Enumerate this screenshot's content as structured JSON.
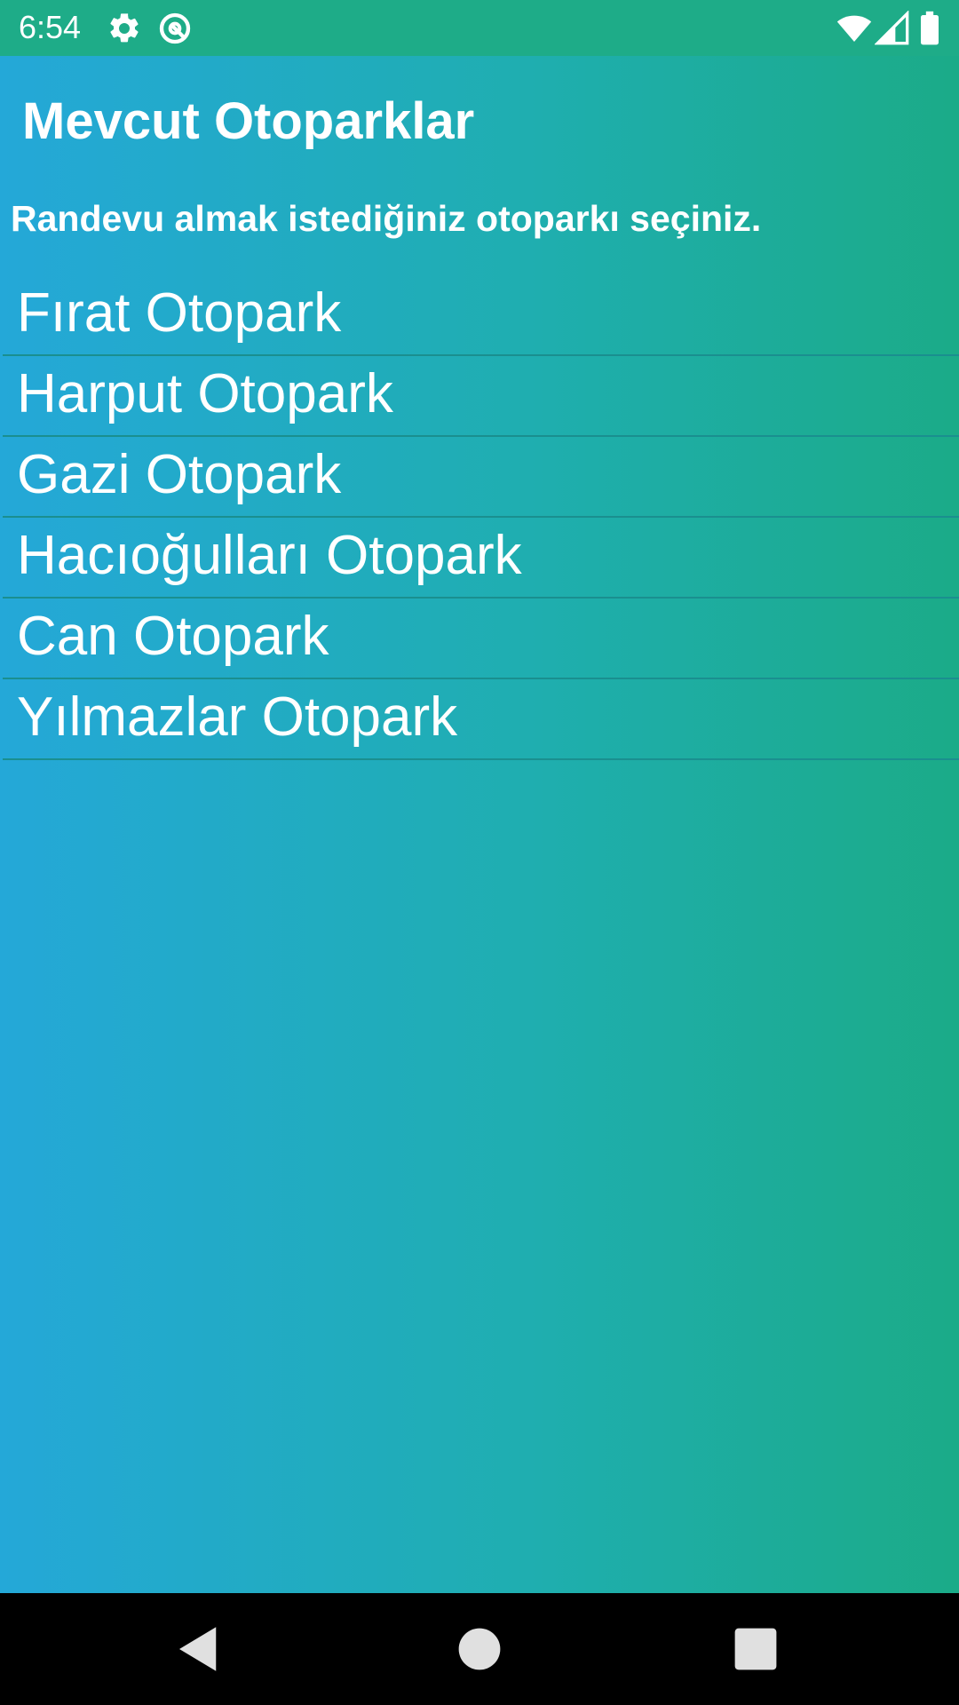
{
  "status_bar": {
    "time": "6:54",
    "icons": [
      "gear-icon",
      "sync-icon",
      "wifi-icon",
      "signal-icon",
      "battery-icon"
    ],
    "background": "#1eac88"
  },
  "header": {
    "title": "Mevcut Otoparklar",
    "subtitle": "Randevu almak istediğiniz otoparkı seçiniz."
  },
  "parking_lots": [
    {
      "label": "Fırat Otopark"
    },
    {
      "label": "Harput Otopark"
    },
    {
      "label": "Gazi Otopark"
    },
    {
      "label": "Hacıoğulları Otopark"
    },
    {
      "label": "Can Otopark"
    },
    {
      "label": "Yılmazlar Otopark"
    }
  ],
  "nav_bar": {
    "buttons": [
      "back-icon",
      "home-icon",
      "recents-icon"
    ]
  },
  "colors": {
    "gradient_left": "#24a8d8",
    "gradient_right": "#1bab88",
    "divider": "#1a8f8f",
    "text": "#ffffff"
  }
}
